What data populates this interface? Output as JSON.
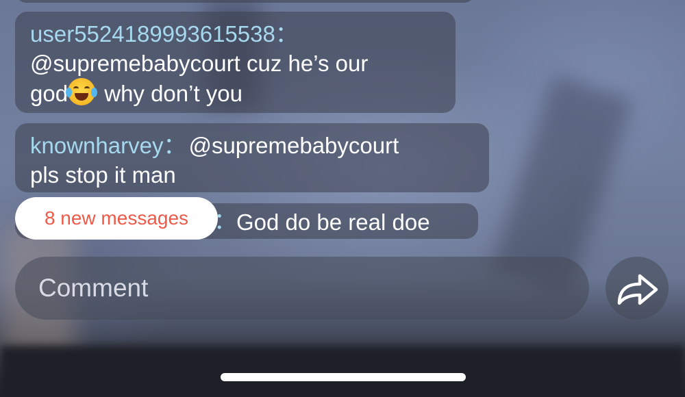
{
  "chat": {
    "messages": [
      {
        "username": "user5524189993615538",
        "separator": "：",
        "line1": "@supremebabycourt cuz he’s our",
        "line2_before": "god",
        "emoji": "face-with-tears-of-joy-icon",
        "line2_after": " why don’t you"
      },
      {
        "username": "knownharvey",
        "separator": "：",
        "text_inline": "@supremebabycourt",
        "line2": "pls stop it man"
      },
      {
        "separator": "：",
        "text": "God do be real doe"
      }
    ],
    "new_messages_label": "8 new messages"
  },
  "comment": {
    "placeholder": "Comment"
  },
  "share": {
    "icon": "share-arrow-icon"
  },
  "colors": {
    "username": "#a6d8ee",
    "new_messages_text": "#ee5a4a",
    "pill_background": "#ffffff"
  }
}
